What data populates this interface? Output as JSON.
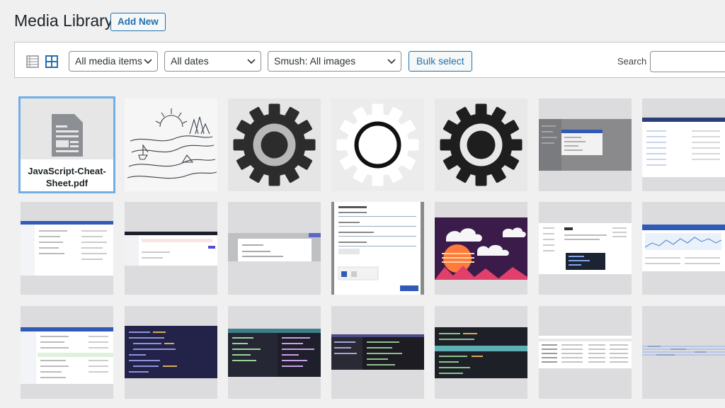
{
  "page": {
    "title": "Media Library",
    "add_new_label": "Add New"
  },
  "toolbar": {
    "view_icons": [
      "list-view-icon",
      "grid-view-icon"
    ],
    "filter_type": "All media items",
    "filter_date": "All dates",
    "filter_smush": "Smush: All images",
    "bulk_select_label": "Bulk select",
    "search_label": "Search",
    "search_value": ""
  },
  "grid": {
    "items": [
      {
        "kind": "document",
        "filename": "JavaScript-Cheat-Sheet.pdf",
        "selected": true
      },
      {
        "kind": "image",
        "thumb": "line-art-landscape"
      },
      {
        "kind": "image",
        "thumb": "gear-dark-gray"
      },
      {
        "kind": "image",
        "thumb": "gear-white"
      },
      {
        "kind": "image",
        "thumb": "gear-dark"
      },
      {
        "kind": "image",
        "thumb": "dropdown-screenshot"
      },
      {
        "kind": "image",
        "thumb": "table-screenshot"
      },
      {
        "kind": "image",
        "thumb": "dashboard-screenshot"
      },
      {
        "kind": "image",
        "thumb": "dark-header-screenshot"
      },
      {
        "kind": "image",
        "thumb": "dialog-screenshot"
      },
      {
        "kind": "image",
        "thumb": "new-site-modal-screenshot"
      },
      {
        "kind": "image",
        "thumb": "synthwave-clouds"
      },
      {
        "kind": "image",
        "thumb": "docs-code-screenshot"
      },
      {
        "kind": "image",
        "thumb": "analytics-chart-screenshot"
      },
      {
        "kind": "image",
        "thumb": "file-list-screenshot"
      },
      {
        "kind": "image",
        "thumb": "dark-code-editor"
      },
      {
        "kind": "image",
        "thumb": "teal-code-editor"
      },
      {
        "kind": "image",
        "thumb": "dark-code-editor-2"
      },
      {
        "kind": "image",
        "thumb": "teal-code-editor-2"
      },
      {
        "kind": "image",
        "thumb": "data-table-screenshot"
      },
      {
        "kind": "image",
        "thumb": "log-list-screenshot"
      }
    ]
  },
  "colors": {
    "accent": "#2271b1",
    "selected_outline": "#72aee6",
    "background": "#f0f0f1"
  }
}
